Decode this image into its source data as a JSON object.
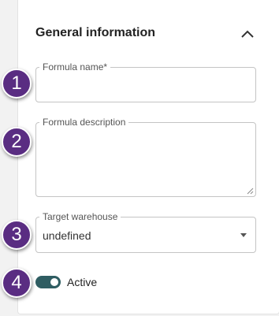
{
  "section": {
    "title": "General information",
    "collapse_icon": "chevron-up-icon"
  },
  "fields": {
    "formula_name": {
      "label": "Formula name",
      "required_marker": "*",
      "value": ""
    },
    "formula_description": {
      "label": "Formula description",
      "value": ""
    },
    "target_warehouse": {
      "label": "Target warehouse",
      "value": "undefined"
    }
  },
  "active_toggle": {
    "label": "Active",
    "on": true,
    "color": "#2f5d62"
  },
  "callouts": [
    "1",
    "2",
    "3",
    "4"
  ],
  "colors": {
    "callout": "#5a2d82"
  }
}
